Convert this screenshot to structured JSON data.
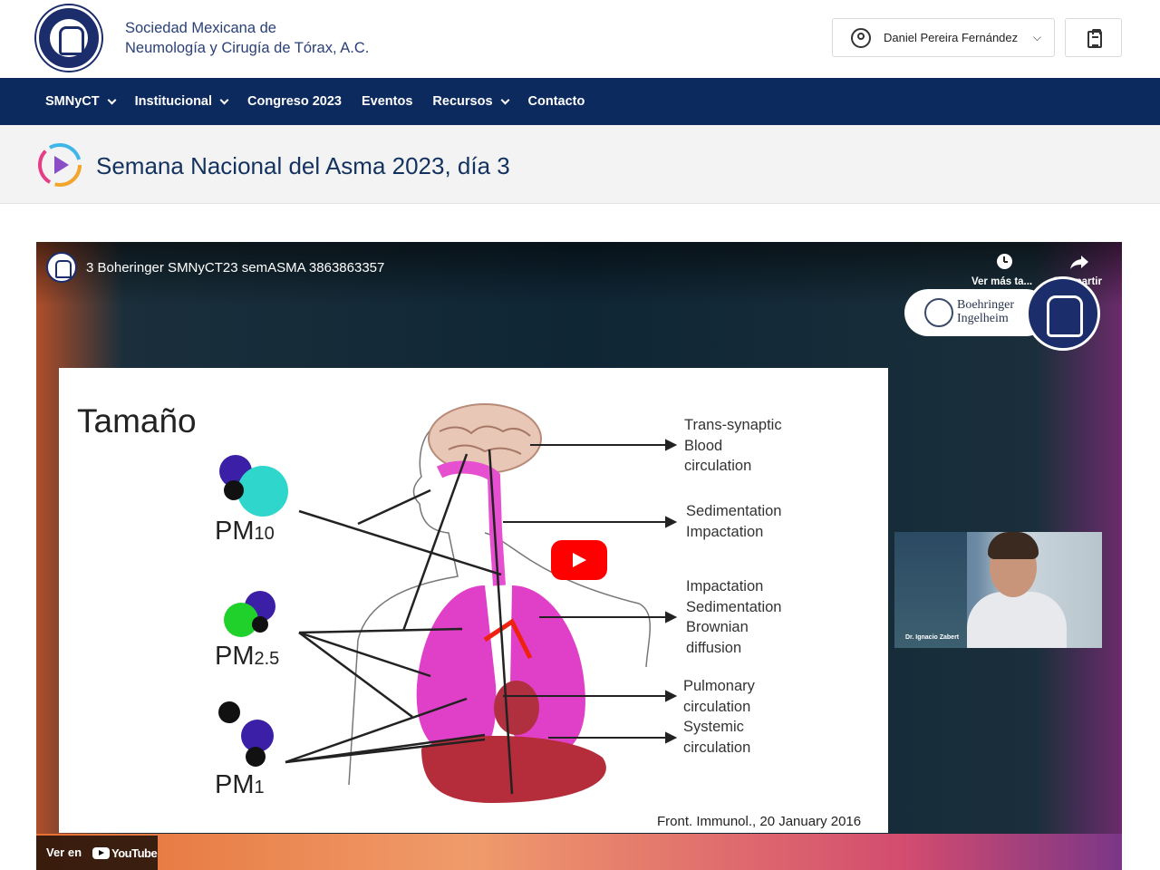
{
  "header": {
    "org_name_line1": "Sociedad Mexicana de",
    "org_name_line2": "Neumología y Cirugía de Tórax, A.C.",
    "user_name": "Daniel Pereira Fernández"
  },
  "nav": {
    "items": [
      {
        "label": "SMNyCT",
        "has_dropdown": true
      },
      {
        "label": "Institucional",
        "has_dropdown": true
      },
      {
        "label": "Congreso 2023",
        "has_dropdown": false
      },
      {
        "label": "Eventos",
        "has_dropdown": false
      },
      {
        "label": "Recursos",
        "has_dropdown": true
      },
      {
        "label": "Contacto",
        "has_dropdown": false
      }
    ]
  },
  "page": {
    "title": "Semana Nacional del Asma 2023, día 3"
  },
  "video": {
    "title": "3 Boheringer SMNyCT23 semASMA 3863863357",
    "watch_later": "Ver más ta...",
    "share": "Compartir",
    "sponsor_line1": "Boehringer",
    "sponsor_line2": "Ingelheim",
    "watch_on": "Ver en",
    "youtube": "YouTube",
    "inset_caption": "Dr. Ignacio Zabert",
    "slide": {
      "title": "Tamaño",
      "pm10": "PM",
      "pm10_sub": "10",
      "pm25": "PM",
      "pm25_sub": "2.5",
      "pm1": "PM",
      "pm1_sub": "1",
      "effect1": [
        "Trans-synaptic",
        "Blood",
        "circulation"
      ],
      "effect2": [
        "Sedimentation",
        "Impactation"
      ],
      "effect3": [
        "Impactation",
        "Sedimentation",
        "Brownian",
        "diffusion"
      ],
      "effect4": [
        "Pulmonary",
        "circulation",
        "Systemic",
        "circulation"
      ],
      "citation": "Front. Immunol., 20 January 2016"
    }
  },
  "colors": {
    "nav_bg": "#0c2a5e",
    "title_text": "#13325f",
    "play_red": "#ff0000"
  }
}
